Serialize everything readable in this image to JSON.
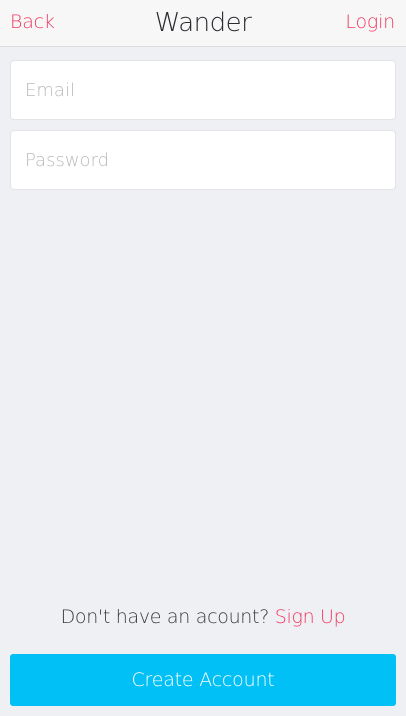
{
  "colors": {
    "accent": "#f0395f",
    "primary_button": "#00c0f5",
    "background": "#eff0f4"
  },
  "nav": {
    "back_label": "Back",
    "title": "Wander",
    "login_label": "Login"
  },
  "form": {
    "email": {
      "value": "",
      "placeholder": "Email"
    },
    "password": {
      "value": "",
      "placeholder": "Password"
    }
  },
  "footer": {
    "prompt": "Don't have an acount?",
    "signup_label": "Sign Up",
    "create_account_label": "Create Account"
  }
}
